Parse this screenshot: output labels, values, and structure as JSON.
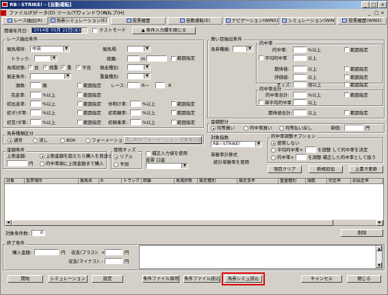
{
  "window": {
    "title": "RB☆STRIKE! - [自動運転]",
    "min": "_",
    "max": "□",
    "close": "×"
  },
  "menu": [
    "ファイル(F)",
    "データ(D)",
    "ツール(T)",
    "ウィンドウ(W)",
    "ヘルプ(H)"
  ],
  "tabs": [
    "レース抽出(R)",
    "馬券シミュレーション(E)",
    "投票履歴",
    "自動運転(E)",
    "ナビゲーション(WIN5)",
    "シミュレーション(WIN5)",
    "投票履歴(WIN5)"
  ],
  "top": {
    "date_label": "開催年月日:",
    "date_value": "2014年 01月 22日(水)",
    "test_mode": "テストモード",
    "load_btn": "▲ 条件入力欄を閉じる"
  },
  "race": {
    "title": "レース抽出条件",
    "place_label": "競馬場所:",
    "place_value": "中央",
    "keiba_label": "競馬場:",
    "track_label": "トラック:",
    "distance_label": "距離:",
    "distance_unit": "m",
    "range": "範囲指定",
    "baba_label": "馬場状態:",
    "baba_opts": [
      "良",
      "稍重",
      "重",
      "不良"
    ],
    "shubetsu_label": "競走種別:",
    "juryo_label": "重量種別:",
    "joken_label": "競走条件:",
    "kumi_label": "頭数:",
    "kumi_unit": "頭",
    "race_label": "レース:",
    "race_mid": "R～",
    "race_unit": "R",
    "kanso_label": "完走率:",
    "ijo": "%以上",
    "shoshin_label": "初出走率:",
    "koken_label": "休明け率:",
    "bomb_label": "初ダ/ダ率:",
    "shokyori_label": "初距離率:",
    "tenba_label": "初芝/ダ率:",
    "hajime_label": "初騎乗率:"
  },
  "hanbai": {
    "title": "馬券種類区分",
    "opts": [
      "通常",
      "流し",
      "BOX",
      "フォーメーション"
    ],
    "btn": "流しBOXフォーメーション 対象馬の設定"
  },
  "money": {
    "title": "金額条件",
    "ue_label": "上限金額:",
    "yen": "円",
    "opt1": "上限金額を超えたら購入を見送る",
    "opt2": "的中率順に上限金額まで購入"
  },
  "use": {
    "title": "使用オッズ",
    "opt1": "リアル",
    "opt2": "予測"
  },
  "hosei": {
    "label": "補正入力値を使用",
    "vote_label": "投票 口座"
  },
  "buy": {
    "title": "買い目抽出条件",
    "baken_label": "馬券種類:",
    "hit_title": "的中率",
    "hit_label": "的中率:",
    "hit_unit": "%以上",
    "avg_label": "平均的中率",
    "avg_unit": "以上",
    "haitou_label": "期待値:",
    "hyoka_label": "評価値:",
    "odds_label": "オッズ:",
    "odds_unit": "倍以上",
    "hit2_title": "的中率合計",
    "hit2_label": "的中率合計:",
    "tan_label": "単平均的中率",
    "kitai_label": "期待値合計:",
    "range": "範囲指定"
  },
  "haibun": {
    "title": "金額配分",
    "opts": [
      "均等買い",
      "的中率買い",
      "均等払い戻し"
    ],
    "tan_label": "単価:",
    "yen": "円"
  },
  "target": {
    "title": "対象指数",
    "value": "RB☆STRIKE!"
  },
  "tanpuku": {
    "title": "単勝率計算式",
    "value": "統計単勝率を使用"
  },
  "adjust": {
    "title": "的中率調整オプション",
    "opt1": "使用しない",
    "opt2": "平均的中率×",
    "opt2b": "を調整 して的中率を決定",
    "opt3": "的中率×",
    "opt3b": "を調整 補正した的中率として扱う"
  },
  "buy_btns": [
    "項目クリア",
    "新規追加",
    "上書き更新"
  ],
  "grid": {
    "cols": [
      "対象",
      "投票場所",
      "競馬名",
      "R",
      "トラック",
      "距離",
      "馬場状態",
      "競走種別",
      "競走条件",
      "重量種別",
      "頭数",
      "完走率",
      "初出走率"
    ],
    "count_label": "対象条件数:",
    "count_value": "0",
    "delete": "削除"
  },
  "end": {
    "title": "終了条件",
    "buy_label": "購入金額:",
    "yen": "円",
    "plus_label": "収支(プラス):",
    "minus_label": "収支(マイナス):",
    "plus_sign": "+",
    "minus_sign": "-"
  },
  "bottom": {
    "start": "開始",
    "sim": "シミュレーション",
    "settings": "設定",
    "save": "条件ファイル保存",
    "load": "条件ファイル読込",
    "sim_load": "馬券シミュ読込",
    "cancel": "キャンセル",
    "close": "閉じる"
  },
  "colors": {
    "face": "#d4d0c8",
    "title_start": "#0a246a",
    "title_end": "#a6caf0",
    "highlight": "#e00000"
  }
}
